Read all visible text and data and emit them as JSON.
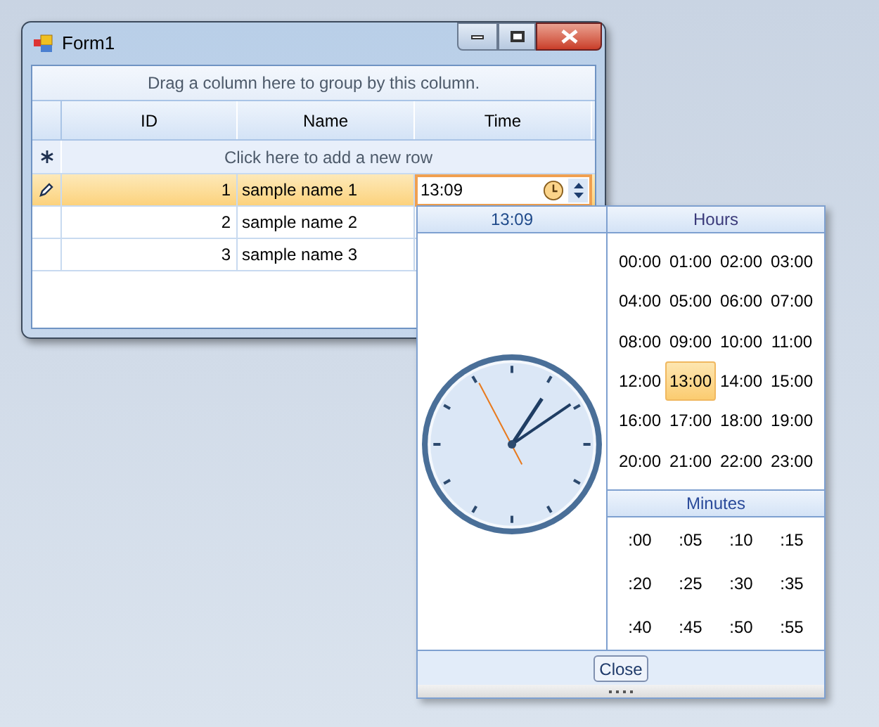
{
  "window": {
    "title": "Form1"
  },
  "grid": {
    "group_panel_hint": "Drag a column here to group by this column.",
    "columns": [
      "ID",
      "Name",
      "Time"
    ],
    "new_row_hint": "Click here to add a new row",
    "rows": [
      {
        "id": "1",
        "name": "sample name 1",
        "time": "13:09",
        "selected": true,
        "editing": true
      },
      {
        "id": "2",
        "name": "sample name 2",
        "selected": false,
        "editing": false
      },
      {
        "id": "3",
        "name": "sample name 3",
        "selected": false,
        "editing": false
      }
    ]
  },
  "time_popup": {
    "header": "13:09",
    "hours_title": "Hours",
    "hours": [
      {
        "label": "00:00",
        "selected": false
      },
      {
        "label": "01:00",
        "selected": false
      },
      {
        "label": "02:00",
        "selected": false
      },
      {
        "label": "03:00",
        "selected": false
      },
      {
        "label": "04:00",
        "selected": false
      },
      {
        "label": "05:00",
        "selected": false
      },
      {
        "label": "06:00",
        "selected": false
      },
      {
        "label": "07:00",
        "selected": false
      },
      {
        "label": "08:00",
        "selected": false
      },
      {
        "label": "09:00",
        "selected": false
      },
      {
        "label": "10:00",
        "selected": false
      },
      {
        "label": "11:00",
        "selected": false
      },
      {
        "label": "12:00",
        "selected": false
      },
      {
        "label": "13:00",
        "selected": true
      },
      {
        "label": "14:00",
        "selected": false
      },
      {
        "label": "15:00",
        "selected": false
      },
      {
        "label": "16:00",
        "selected": false
      },
      {
        "label": "17:00",
        "selected": false
      },
      {
        "label": "18:00",
        "selected": false
      },
      {
        "label": "19:00",
        "selected": false
      },
      {
        "label": "20:00",
        "selected": false
      },
      {
        "label": "21:00",
        "selected": false
      },
      {
        "label": "22:00",
        "selected": false
      },
      {
        "label": "23:00",
        "selected": false
      }
    ],
    "minutes_title": "Minutes",
    "minutes": [
      {
        "label": ":00",
        "selected": false
      },
      {
        "label": ":05",
        "selected": false
      },
      {
        "label": ":10",
        "selected": false
      },
      {
        "label": ":15",
        "selected": false
      },
      {
        "label": ":20",
        "selected": false
      },
      {
        "label": ":25",
        "selected": false
      },
      {
        "label": ":30",
        "selected": false
      },
      {
        "label": ":35",
        "selected": false
      },
      {
        "label": ":40",
        "selected": false
      },
      {
        "label": ":45",
        "selected": false
      },
      {
        "label": ":50",
        "selected": false
      },
      {
        "label": ":55",
        "selected": false
      }
    ],
    "close_button": "Close"
  }
}
